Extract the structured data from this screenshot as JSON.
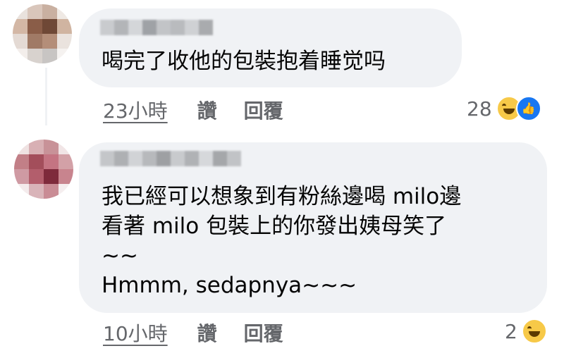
{
  "comments": [
    {
      "text": "喝完了收他的包裝抱着睡觉吗",
      "time": "23小時",
      "like_label": "讚",
      "reply_label": "回覆",
      "reaction_count": "28",
      "reactions": [
        "haha-icon",
        "like-icon"
      ]
    },
    {
      "text_lines": [
        "我已經可以想象到有粉絲邊喝 milo邊",
        "看著 milo 包裝上的你發出姨母笑了",
        "~~",
        "Hmmm, sedapnya~~~"
      ],
      "time": "10小時",
      "like_label": "讚",
      "reply_label": "回覆",
      "reaction_count": "2",
      "reactions": [
        "haha-icon"
      ]
    }
  ],
  "colors": {
    "bubble": "#f0f2f5",
    "meta_text": "#65676b",
    "like_blue": "#1877f2",
    "haha_yellow": "#f7c948"
  }
}
